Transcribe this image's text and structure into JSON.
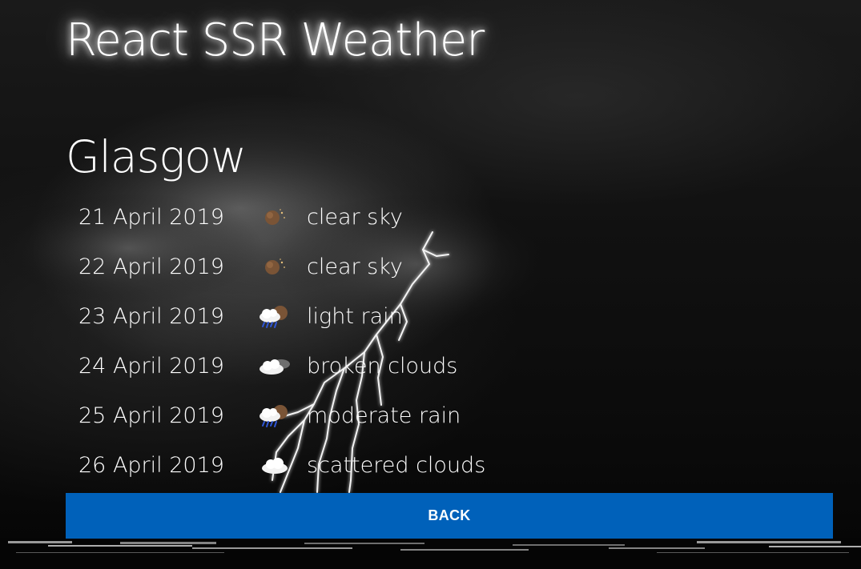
{
  "app": {
    "title": "React SSR Weather"
  },
  "city": {
    "name": "Glasgow"
  },
  "forecast": [
    {
      "date": "21 April 2019",
      "icon": "clear-sky-night-icon",
      "description": "clear sky"
    },
    {
      "date": "22 April 2019",
      "icon": "clear-sky-night-icon",
      "description": "clear sky"
    },
    {
      "date": "23 April 2019",
      "icon": "rain-night-icon",
      "description": "light rain"
    },
    {
      "date": "24 April 2019",
      "icon": "broken-clouds-night-icon",
      "description": "broken clouds"
    },
    {
      "date": "25 April 2019",
      "icon": "rain-night-icon",
      "description": "moderate rain"
    },
    {
      "date": "26 April 2019",
      "icon": "scattered-clouds-icon",
      "description": "scattered clouds"
    }
  ],
  "actions": {
    "back_label": "BACK"
  },
  "colors": {
    "button": "#0061ba",
    "text": "#ffffff",
    "background": "#000000"
  }
}
